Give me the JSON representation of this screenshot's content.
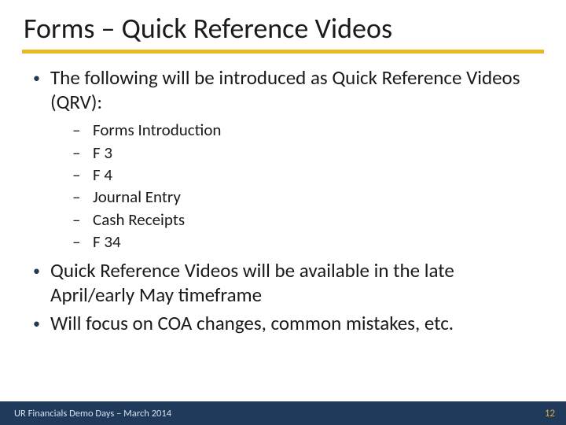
{
  "title": "Forms – Quick Reference Videos",
  "bullets": [
    "The following will be introduced as Quick Reference Videos (QRV):"
  ],
  "sub_items": [
    "Forms Introduction",
    "F 3",
    "F 4",
    "Journal Entry",
    "Cash Receipts",
    "F 34"
  ],
  "bullets_after": [
    "Quick Reference Videos will be available in the late April/early May timeframe",
    "Will focus on COA changes, common mistakes, etc."
  ],
  "footer": {
    "left": "UR Financials Demo Days – March 2014",
    "right": "12"
  },
  "colors": {
    "accent_rule": "#e8b922",
    "footer_bg": "#1f3a5a",
    "page_number": "#e6a93a"
  }
}
